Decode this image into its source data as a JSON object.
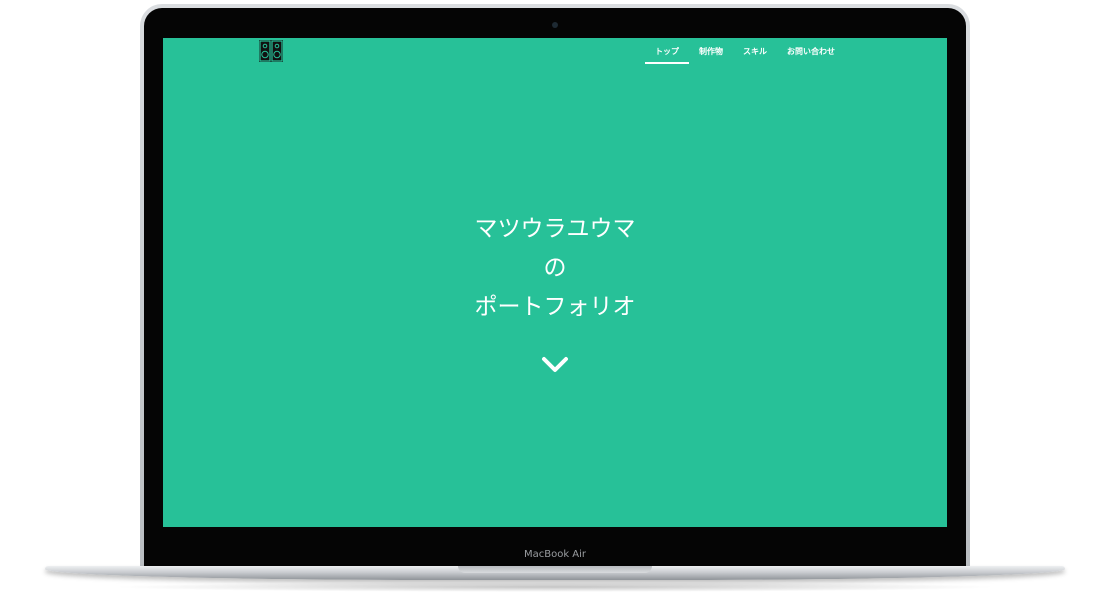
{
  "nav": {
    "items": [
      {
        "label": "トップ",
        "active": true
      },
      {
        "label": "制作物",
        "active": false
      },
      {
        "label": "スキル",
        "active": false
      },
      {
        "label": "お問い合わせ",
        "active": false
      }
    ]
  },
  "hero": {
    "line1": "マツウラユウマ",
    "line2": "の",
    "line3": "ポートフォリオ"
  },
  "device": {
    "label": "MacBook Air"
  },
  "icons": {
    "logo": "speaker-logo-icon",
    "scroll": "chevron-down-icon"
  },
  "colors": {
    "accent": "#27c198",
    "text": "#ffffff"
  }
}
